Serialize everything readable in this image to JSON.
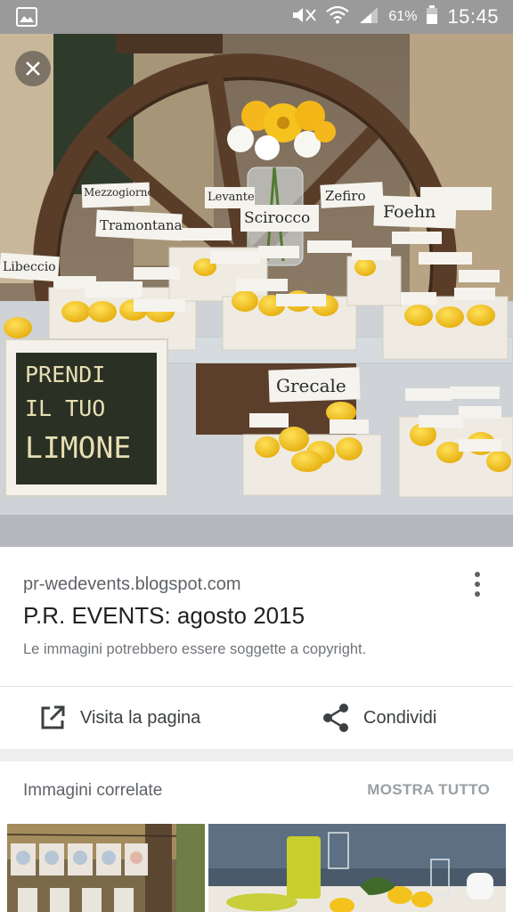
{
  "status_bar": {
    "battery_percent": "61%",
    "time": "15:45",
    "icons": [
      "gallery-icon",
      "mute-icon",
      "wifi-icon",
      "signal-icon",
      "battery-icon"
    ]
  },
  "photo": {
    "chalkboard": {
      "line1": "PRENDI",
      "line2": "IL TUO",
      "line3": "LIMONE"
    },
    "cards": [
      "Mezzogiorno",
      "Levante",
      "Zefiro",
      "Scirocco",
      "Foehn",
      "Tramontana",
      "Libeccio",
      "Grecale"
    ],
    "close_icon": "close-icon"
  },
  "result": {
    "source": "pr-wedevents.blogspot.com",
    "title": "P.R. EVENTS: agosto 2015",
    "copyright": "Le immagini potrebbero essere soggette a copyright.",
    "more_icon": "more-vert-icon"
  },
  "actions": {
    "visit_label": "Visita la pagina",
    "visit_icon": "open-in-new-icon",
    "share_label": "Condividi",
    "share_icon": "share-icon"
  },
  "related": {
    "title": "Immagini correlate",
    "show_all": "MOSTRA TUTTO"
  },
  "colors": {
    "status_bar": "#9a9a9a",
    "text_primary": "#202124",
    "text_secondary": "#5f6368",
    "lemon": "#f2c21b",
    "chalkboard": "#2b3024"
  }
}
